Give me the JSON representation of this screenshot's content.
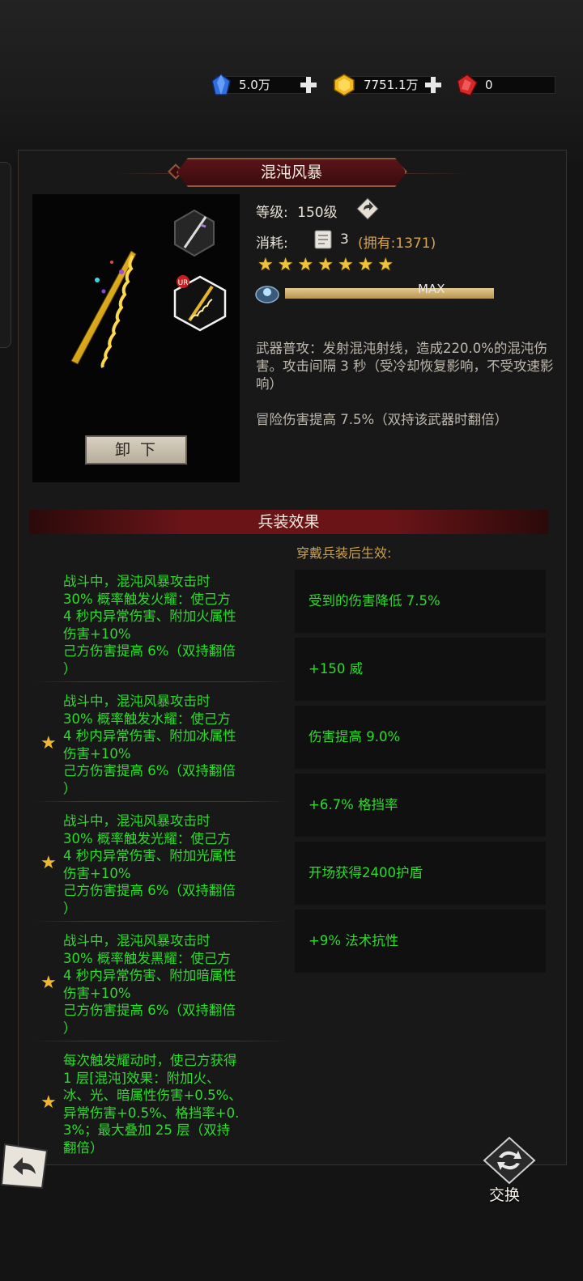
{
  "currency": {
    "blue": {
      "value": "5.0万",
      "icon": "blue-crystal-icon",
      "color": "#3a7ae8"
    },
    "gold": {
      "value": "7751.1万",
      "icon": "gold-coin-icon",
      "color": "#f2b81c"
    },
    "red": {
      "value": "0",
      "icon": "red-gem-icon",
      "color": "#d62828"
    }
  },
  "weapon": {
    "name": "混沌风暴",
    "level_label": "等级:",
    "level_value": "150级",
    "cost_label": "消耗:",
    "cost_amount": "3",
    "cost_owned": "(拥有:1371)",
    "stars": 7,
    "progress_label": "MAX",
    "progress_fraction": 1.0,
    "rarity_badge": "UR",
    "unequip_label": "卸下",
    "desc1": "武器普攻：发射混沌射线，造成220.0%的混沌伤害。攻击间隔 3 秒（受冷却恢复影响，不受攻速影响）",
    "desc2": "冒险伤害提高 7.5%（双持该武器时翻倍）"
  },
  "section": {
    "title": "兵装效果",
    "right_caption": "穿戴兵装后生效:"
  },
  "effects": [
    {
      "starred": false,
      "lines": [
        "战斗中，混沌风暴攻击时",
        "30% 概率触发火耀：使己方",
        "4 秒内异常伤害、附加火属性",
        "伤害+10%",
        "己方伤害提高 6%（双持翻倍",
        "）"
      ]
    },
    {
      "starred": true,
      "lines": [
        "战斗中，混沌风暴攻击时",
        "30% 概率触发水耀：使己方",
        "4 秒内异常伤害、附加冰属性",
        "伤害+10%",
        "己方伤害提高 6%（双持翻倍",
        "）"
      ]
    },
    {
      "starred": true,
      "lines": [
        "战斗中，混沌风暴攻击时",
        "30% 概率触发光耀：使己方",
        "4 秒内异常伤害、附加光属性",
        "伤害+10%",
        "己方伤害提高 6%（双持翻倍",
        "）"
      ]
    },
    {
      "starred": true,
      "lines": [
        "战斗中，混沌风暴攻击时",
        "30% 概率触发黑耀：使己方",
        "4 秒内异常伤害、附加暗属性",
        "伤害+10%",
        "己方伤害提高 6%（双持翻倍",
        "）"
      ]
    },
    {
      "starred": true,
      "lines": [
        "每次触发耀动时，使己方获得",
        "1 层[混沌]效果：附加火、",
        "冰、光、暗属性伤害+0.5%、",
        "异常伤害+0.5%、格挡率+0.",
        "3%；最大叠加 25 层（双持",
        "翻倍）"
      ]
    }
  ],
  "bonuses": [
    "受到的伤害降低 7.5%",
    "+150 威",
    "伤害提高 9.0%",
    "+6.7% 格挡率",
    "开场获得2400护盾",
    "+9% 法术抗性"
  ],
  "footer": {
    "back_icon": "back-arrow-icon",
    "swap_label": "交换",
    "swap_icon": "swap-icon"
  }
}
